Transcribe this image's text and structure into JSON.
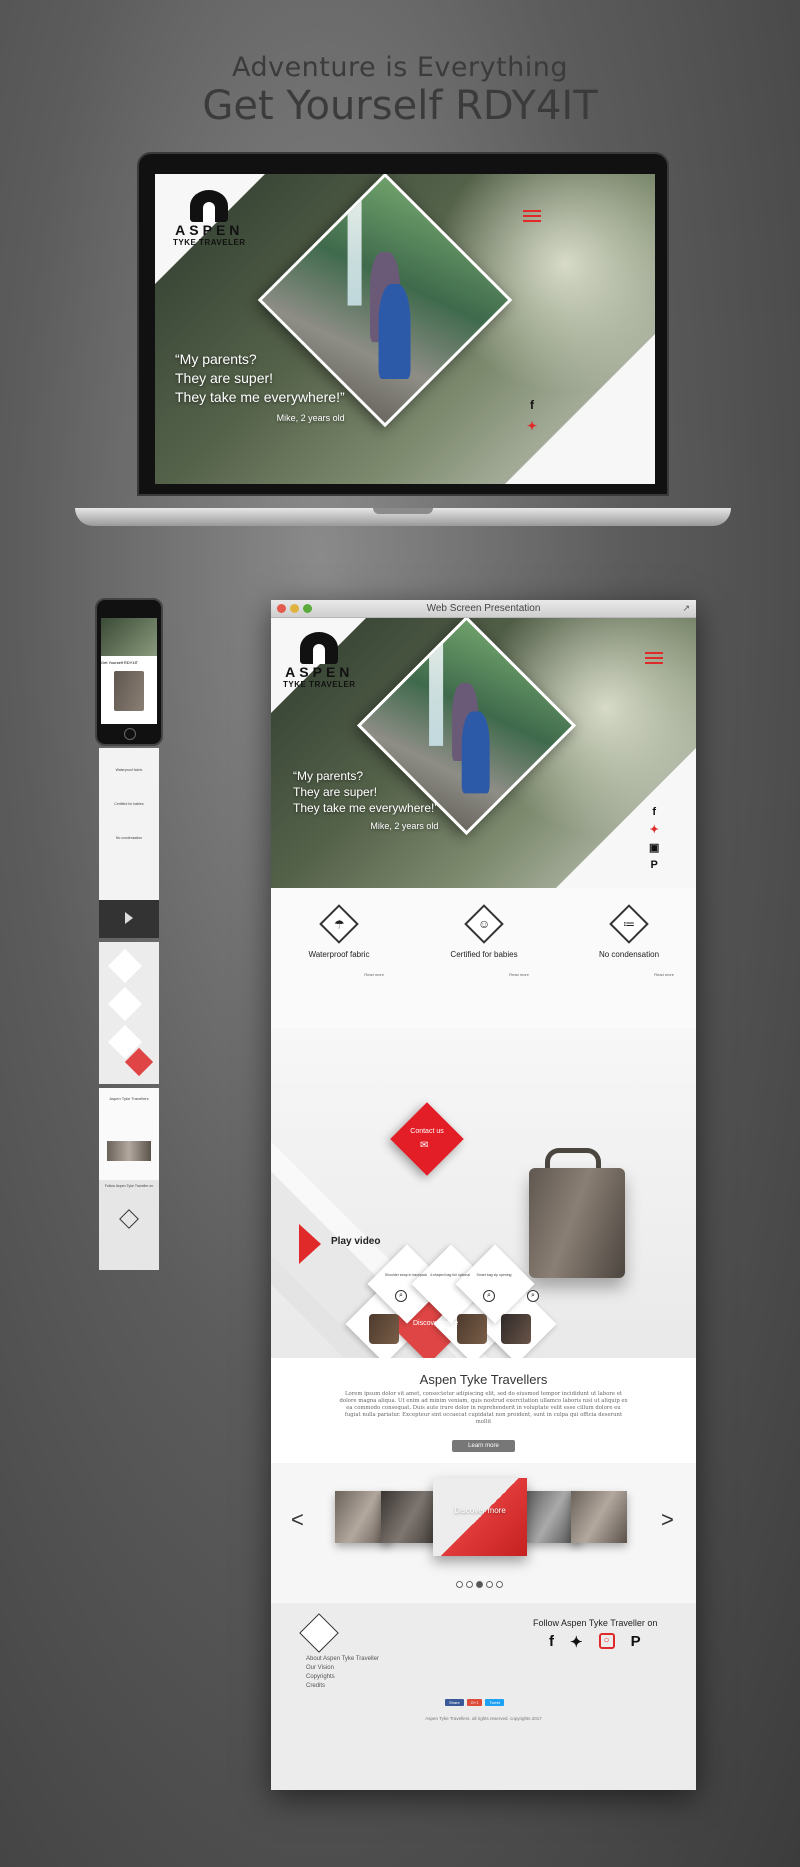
{
  "tagline": {
    "line1": "Adventure is Everything",
    "line2": "Get Yourself RDY4IT"
  },
  "brand": {
    "name": "ASPEN",
    "subtitle": "TYKE TRAVELER"
  },
  "hero": {
    "quote_lines": [
      "“My parents?",
      "They are super!",
      "They take me everywhere!”"
    ],
    "author": "Mike, 2 years old"
  },
  "browser": {
    "title": "Web Screen Presentation"
  },
  "social": [
    "facebook",
    "twitter",
    "instagram",
    "pinterest"
  ],
  "features": [
    {
      "title": "Waterproof fabric",
      "icon": "umbrella-icon",
      "more": "Read more"
    },
    {
      "title": "Certified for babies",
      "icon": "baby-icon",
      "more": "Read more"
    },
    {
      "title": "No condensation",
      "icon": "droplets-icon",
      "more": "Read more"
    }
  ],
  "cta": {
    "contact": "Contact us",
    "play": "Play video",
    "discover": "Discover more"
  },
  "products": [
    {
      "label": "Shoulder strap in backpack"
    },
    {
      "label": "4-shaped bag full optional"
    },
    {
      "label": "Smart bag zip opening"
    }
  ],
  "about": {
    "title": "Aspen Tyke Travellers",
    "body": "Lorem ipsum dolor sit amet, consectetur adipiscing elit, sed do eiusmod tempor incididunt ut labore et dolore magna aliqua. Ut enim ad minim veniam, quis nostrud exercitation ullamco laboris nisi ut aliquip ex ea commodo consequat. Duis aute irure dolor in reprehenderit in voluptate velit esse cillum dolore eu fugiat nulla pariatur. Excepteur sint occaecat cupidatat non proident, sunt in culpa qui officia deserunt mollit",
    "button": "Learn more"
  },
  "carousel": {
    "prev": "<",
    "next": ">",
    "discover": "Discover more",
    "active_index": 2,
    "dots": 5
  },
  "footer": {
    "follow": "Follow Aspen Tyke Traveller on",
    "links": [
      "About Aspen Tyke Traveller",
      "Our Vision",
      "Copyrights",
      "Credits"
    ],
    "share": [
      "Share",
      "G+1",
      "Tweet"
    ],
    "copyright": "Aspen Tyke Travellers. all rights reserved. copyrights 2017"
  },
  "colors": {
    "accent": "#e02a2a",
    "background": "#5c5c5c"
  }
}
